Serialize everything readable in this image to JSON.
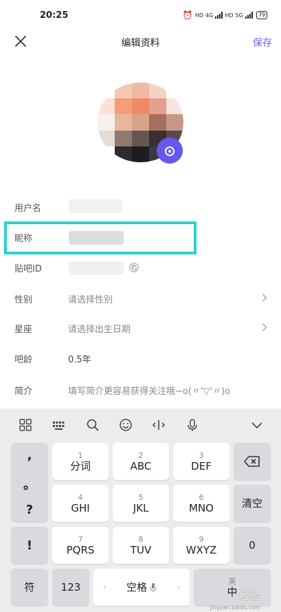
{
  "status_bar": {
    "time": "20:25",
    "net1": "HD",
    "net1_gen": "4G",
    "net2": "HD",
    "net2_gen": "5G",
    "battery": "79"
  },
  "nav": {
    "title": "编辑资料",
    "save_label": "保存",
    "accent": "#6a5cf0"
  },
  "profile": {
    "rows": [
      {
        "label": "用户名",
        "value": ""
      },
      {
        "label": "昵称",
        "value": ""
      },
      {
        "label": "贴吧ID",
        "value": ""
      },
      {
        "label": "性别",
        "value": "请选择性别"
      },
      {
        "label": "星座",
        "value": "请选择出生日期"
      },
      {
        "label": "吧龄",
        "value": "0.5年"
      },
      {
        "label": "简介",
        "value": "填写简介更容易获得关注哦~o(〃'▽'〃)o"
      }
    ],
    "highlight_color": "#27d3cf"
  },
  "keyboard": {
    "toolbar": [
      "grid-icon",
      "keyboard-icon",
      "search-icon",
      "emoji-icon",
      "cursor-icon",
      "mic-icon",
      "collapse-icon"
    ],
    "left_column": [
      ",",
      "。",
      "?",
      "!"
    ],
    "keys": [
      {
        "num": "1",
        "label": "分词"
      },
      {
        "num": "2",
        "label": "ABC"
      },
      {
        "num": "3",
        "label": "DEF"
      },
      {
        "num": "4",
        "label": "GHI"
      },
      {
        "num": "5",
        "label": "JKL"
      },
      {
        "num": "6",
        "label": "MNO"
      },
      {
        "num": "7",
        "label": "PQRS"
      },
      {
        "num": "8",
        "label": "TUV"
      },
      {
        "num": "9",
        "label": "WXYZ"
      }
    ],
    "right_column": {
      "clear": "清空",
      "zero": "0"
    },
    "bottom": {
      "symbol": "符",
      "numeric": "123",
      "space": "空格",
      "lang": "英",
      "lang_sub": "中"
    },
    "watermark": "经验",
    "watermark_sub": "jingyan.baidu.com"
  }
}
